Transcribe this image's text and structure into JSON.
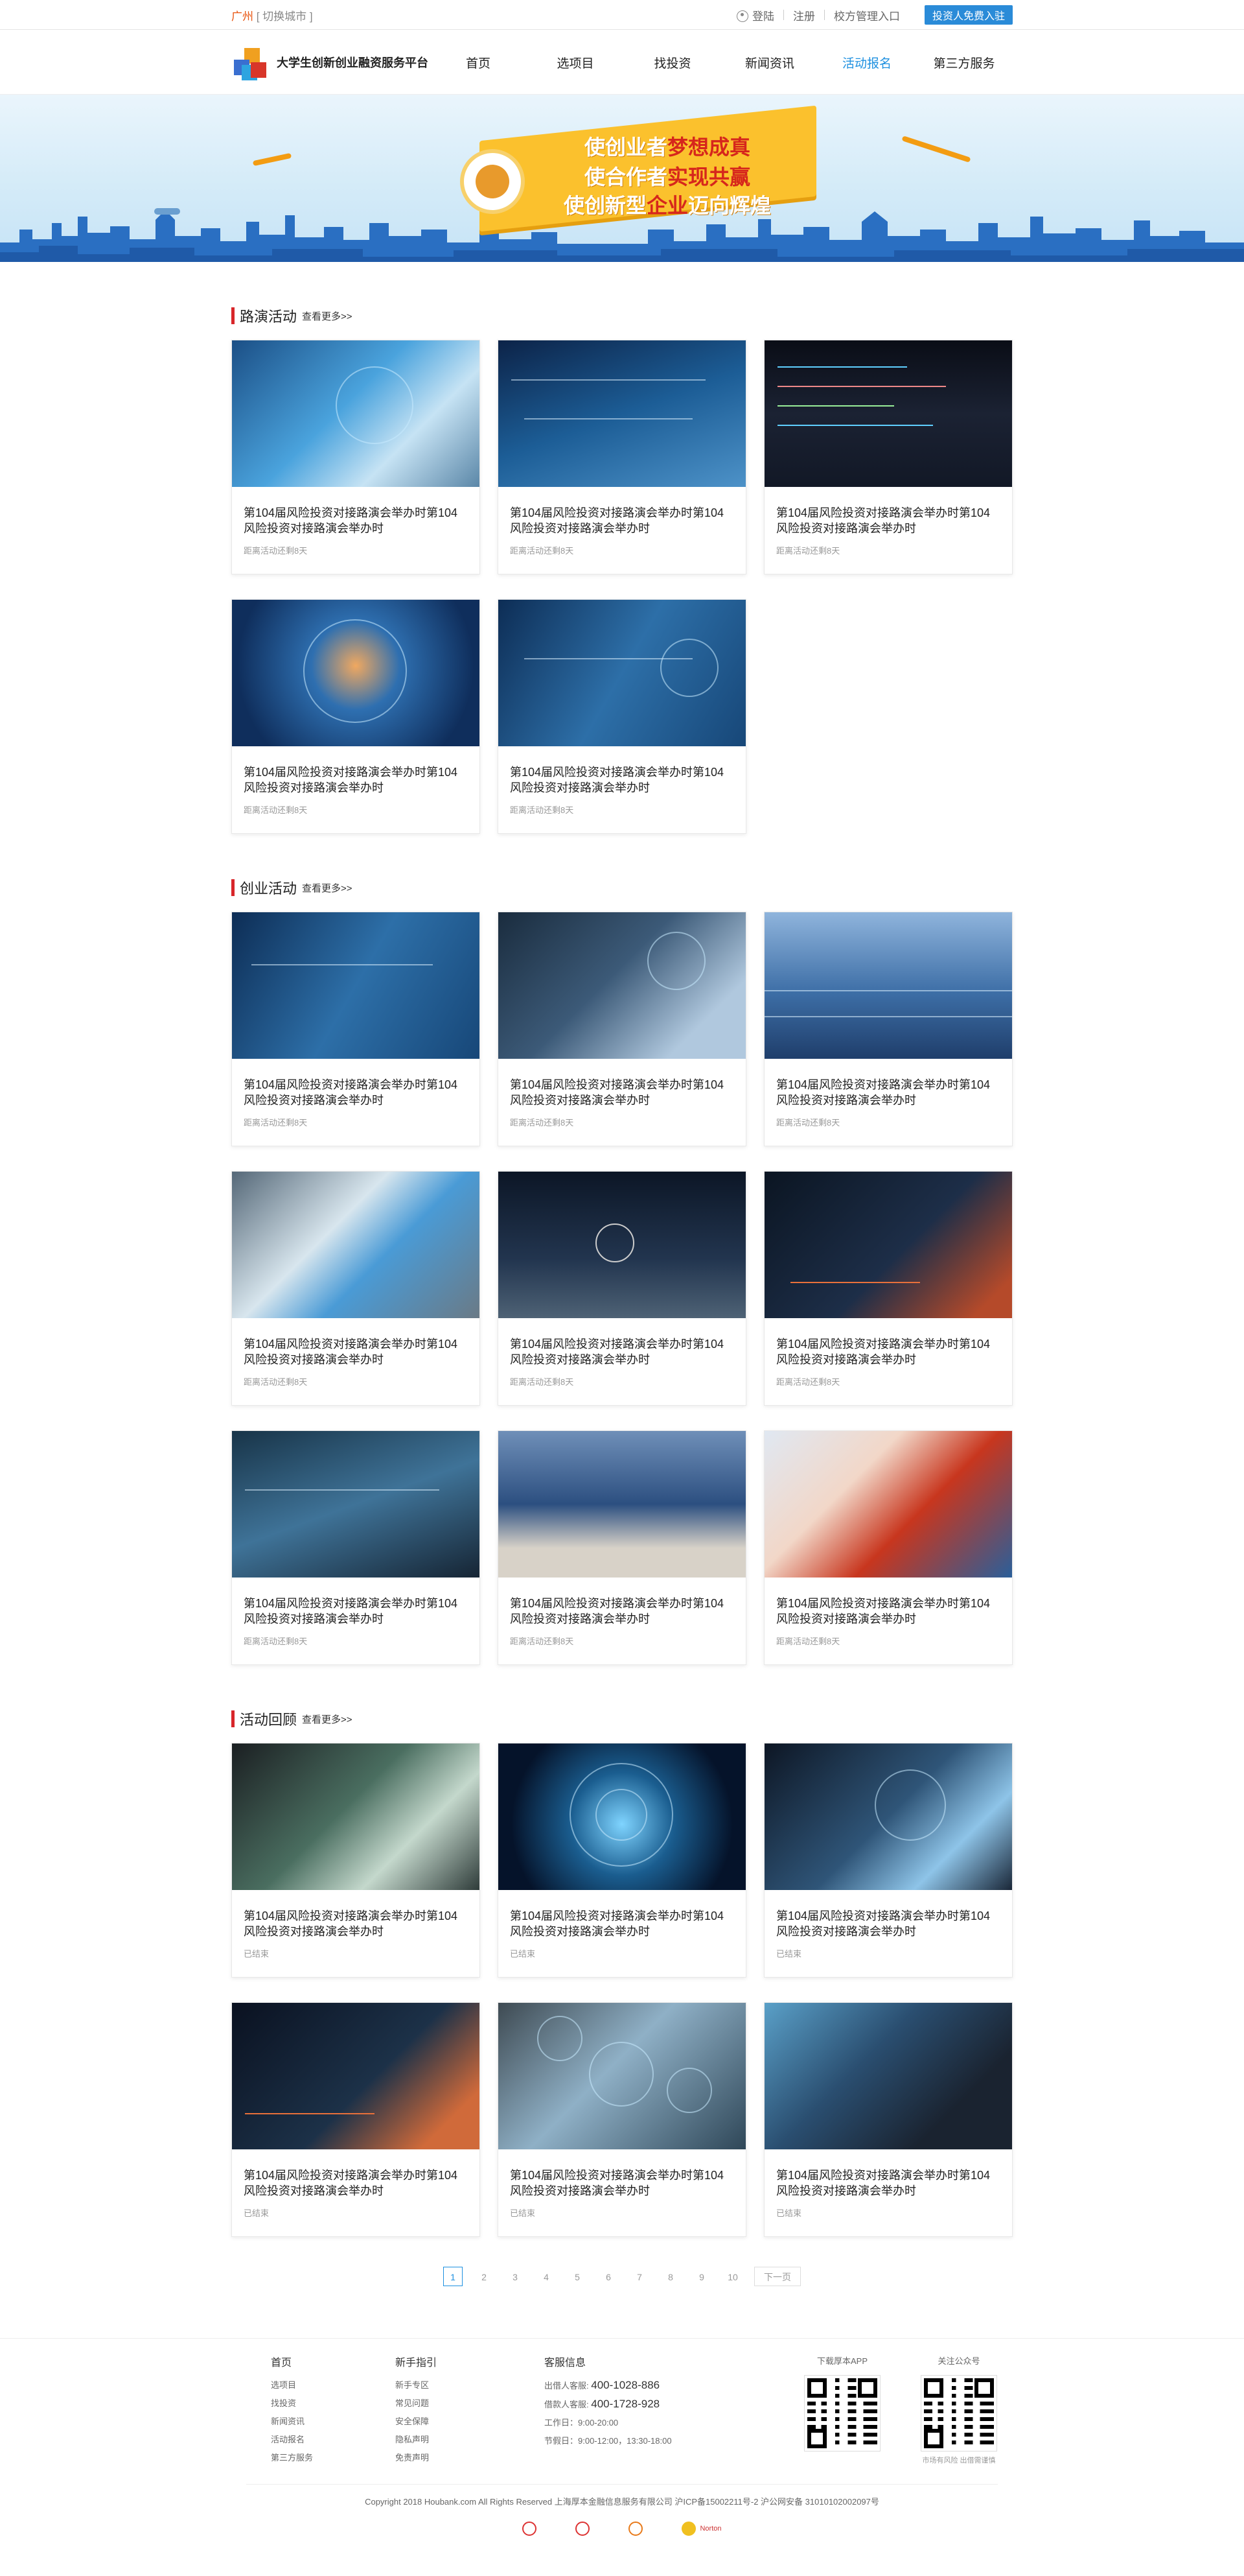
{
  "topbar": {
    "city": "广州",
    "switch_city": "[ 切换城市 ]",
    "login": "登陆",
    "register": "注册",
    "school_admin": "校方管理入口",
    "investor_btn": "投资人免费入驻"
  },
  "header": {
    "logo_text": "大学生创新创业融资服务平台",
    "nav": [
      "首页",
      "选项目",
      "找投资",
      "新闻资讯",
      "活动报名",
      "第三方服务"
    ]
  },
  "banner": {
    "line1_a": "使创业者",
    "line1_b": "梦想成真",
    "line2_a": "使合作者",
    "line2_b": "实现共赢",
    "line3_a": "使创新型",
    "line3_b": "企业",
    "line3_c": "迈向辉煌"
  },
  "sections": [
    {
      "title": "路演活动",
      "more": "查看更多>>",
      "cards": [
        {
          "title": "第104届风险投资对接路演会举办时第104风险投资对接路演会举办时",
          "status": "距离活动还剩8天"
        },
        {
          "title": "第104届风险投资对接路演会举办时第104风险投资对接路演会举办时",
          "status": "距离活动还剩8天"
        },
        {
          "title": "第104届风险投资对接路演会举办时第104风险投资对接路演会举办时",
          "status": "距离活动还剩8天"
        },
        {
          "title": "第104届风险投资对接路演会举办时第104风险投资对接路演会举办时",
          "status": "距离活动还剩8天"
        },
        {
          "title": "第104届风险投资对接路演会举办时第104风险投资对接路演会举办时",
          "status": "距离活动还剩8天"
        }
      ]
    },
    {
      "title": "创业活动",
      "more": "查看更多>>",
      "cards": [
        {
          "title": "第104届风险投资对接路演会举办时第104风险投资对接路演会举办时",
          "status": "距离活动还剩8天"
        },
        {
          "title": "第104届风险投资对接路演会举办时第104风险投资对接路演会举办时",
          "status": "距离活动还剩8天"
        },
        {
          "title": "第104届风险投资对接路演会举办时第104风险投资对接路演会举办时",
          "status": "距离活动还剩8天"
        },
        {
          "title": "第104届风险投资对接路演会举办时第104风险投资对接路演会举办时",
          "status": "距离活动还剩8天"
        },
        {
          "title": "第104届风险投资对接路演会举办时第104风险投资对接路演会举办时",
          "status": "距离活动还剩8天"
        },
        {
          "title": "第104届风险投资对接路演会举办时第104风险投资对接路演会举办时",
          "status": "距离活动还剩8天"
        },
        {
          "title": "第104届风险投资对接路演会举办时第104风险投资对接路演会举办时",
          "status": "距离活动还剩8天"
        },
        {
          "title": "第104届风险投资对接路演会举办时第104风险投资对接路演会举办时",
          "status": "距离活动还剩8天"
        },
        {
          "title": "第104届风险投资对接路演会举办时第104风险投资对接路演会举办时",
          "status": "距离活动还剩8天"
        }
      ]
    },
    {
      "title": "活动回顾",
      "more": "查看更多>>",
      "cards": [
        {
          "title": "第104届风险投资对接路演会举办时第104风险投资对接路演会举办时",
          "status": "已结束"
        },
        {
          "title": "第104届风险投资对接路演会举办时第104风险投资对接路演会举办时",
          "status": "已结束"
        },
        {
          "title": "第104届风险投资对接路演会举办时第104风险投资对接路演会举办时",
          "status": "已结束"
        },
        {
          "title": "第104届风险投资对接路演会举办时第104风险投资对接路演会举办时",
          "status": "已结束"
        },
        {
          "title": "第104届风险投资对接路演会举办时第104风险投资对接路演会举办时",
          "status": "已结束"
        },
        {
          "title": "第104届风险投资对接路演会举办时第104风险投资对接路演会举办时",
          "status": "已结束"
        }
      ]
    }
  ],
  "pagination": {
    "pages": [
      "1",
      "2",
      "3",
      "4",
      "5",
      "6",
      "7",
      "8",
      "9",
      "10"
    ],
    "current": "1",
    "next": "下一页"
  },
  "footer": {
    "col1": {
      "title": "首页",
      "items": [
        "选项目",
        "找投资",
        "新闻资讯",
        "活动报名",
        "第三方服务"
      ]
    },
    "col2": {
      "title": "新手指引",
      "items": [
        "新手专区",
        "常见问题",
        "安全保障",
        "隐私声明",
        "免责声明"
      ]
    },
    "col3": {
      "title": "客服信息",
      "line1_label": "出借人客服:",
      "line1_value": "400-1028-886",
      "line2_label": "借款人客服:",
      "line2_value": "400-1728-928",
      "line3": "工作日：9:00-20:00",
      "line4": "节假日：9:00-12:00，13:30-18:00"
    },
    "qr1": {
      "label": "下载厚本APP"
    },
    "qr2": {
      "label": "关注公众号",
      "sub": "市场有风险 出借需谨慎"
    },
    "copyright": "Copyright 2018 Houbank.com All Rights Reserved   上海厚本金融信息服务有限公司   沪ICP备15002211号-2   沪公网安备 31010102002097号",
    "badges": [
      "",
      "",
      "",
      "Norton"
    ]
  },
  "colors": {
    "accent": "#1e90e0",
    "section_bar": "#d8262a",
    "city": "#e8530e"
  }
}
